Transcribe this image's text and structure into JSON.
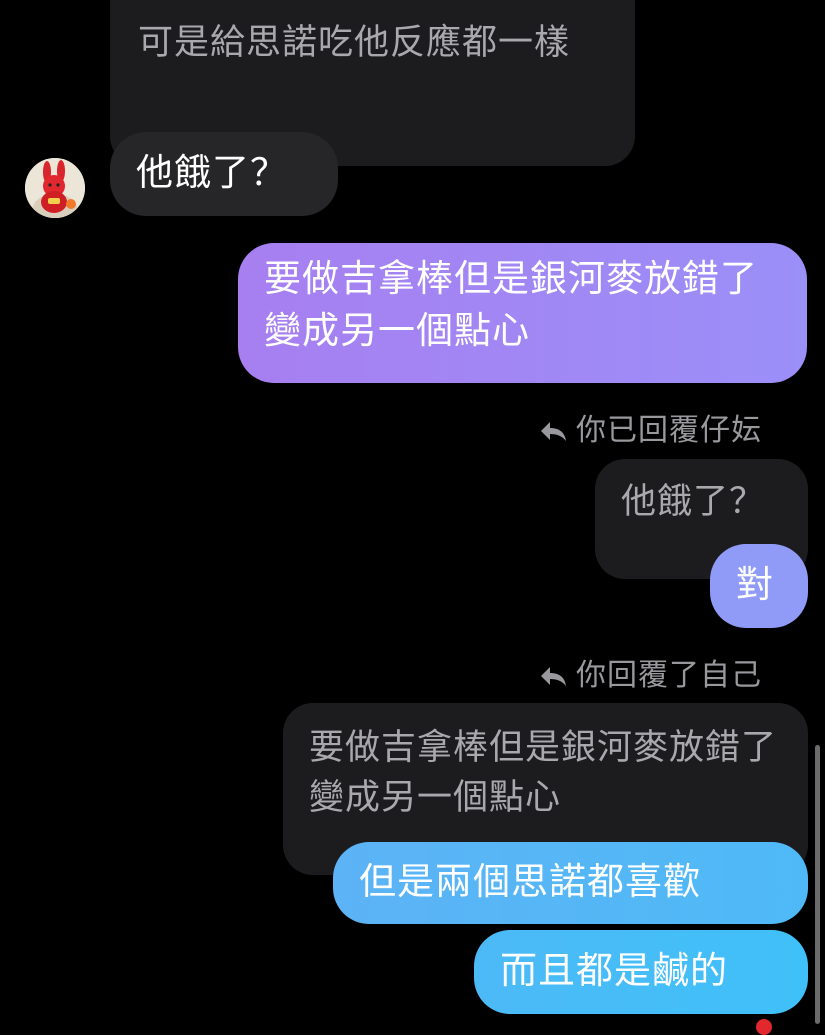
{
  "messages": {
    "quoted_top": "可是給思諾吃他反應都一樣",
    "incoming_reply": "他餓了？",
    "outgoing_purple": "要做吉拿棒但是銀河麥放錯了變成另一個點心",
    "reply_label_1": "你已回覆仔妘",
    "quoted_mid": "他餓了？",
    "outgoing_short": "對",
    "reply_label_2": "你回覆了自己",
    "quoted_bottom": "要做吉拿棒但是銀河麥放錯了變成另一個點心",
    "outgoing_blue_1": "但是兩個思諾都喜歡",
    "outgoing_blue_2": "而且都是鹹的"
  },
  "icons": {
    "reply": "reply-arrow-icon",
    "avatar": "contact-avatar"
  },
  "colors": {
    "background": "#000000",
    "incoming_bubble": "#262628",
    "quoted_bubble": "#1c1c1e",
    "purple_gradient_start": "#a77ff0",
    "purple_gradient_end": "#9b8ff8",
    "blue_gradient_start": "#5cb3f5",
    "blue_gradient_end": "#40c0f8",
    "periwinkle": "#8f9bf7"
  }
}
